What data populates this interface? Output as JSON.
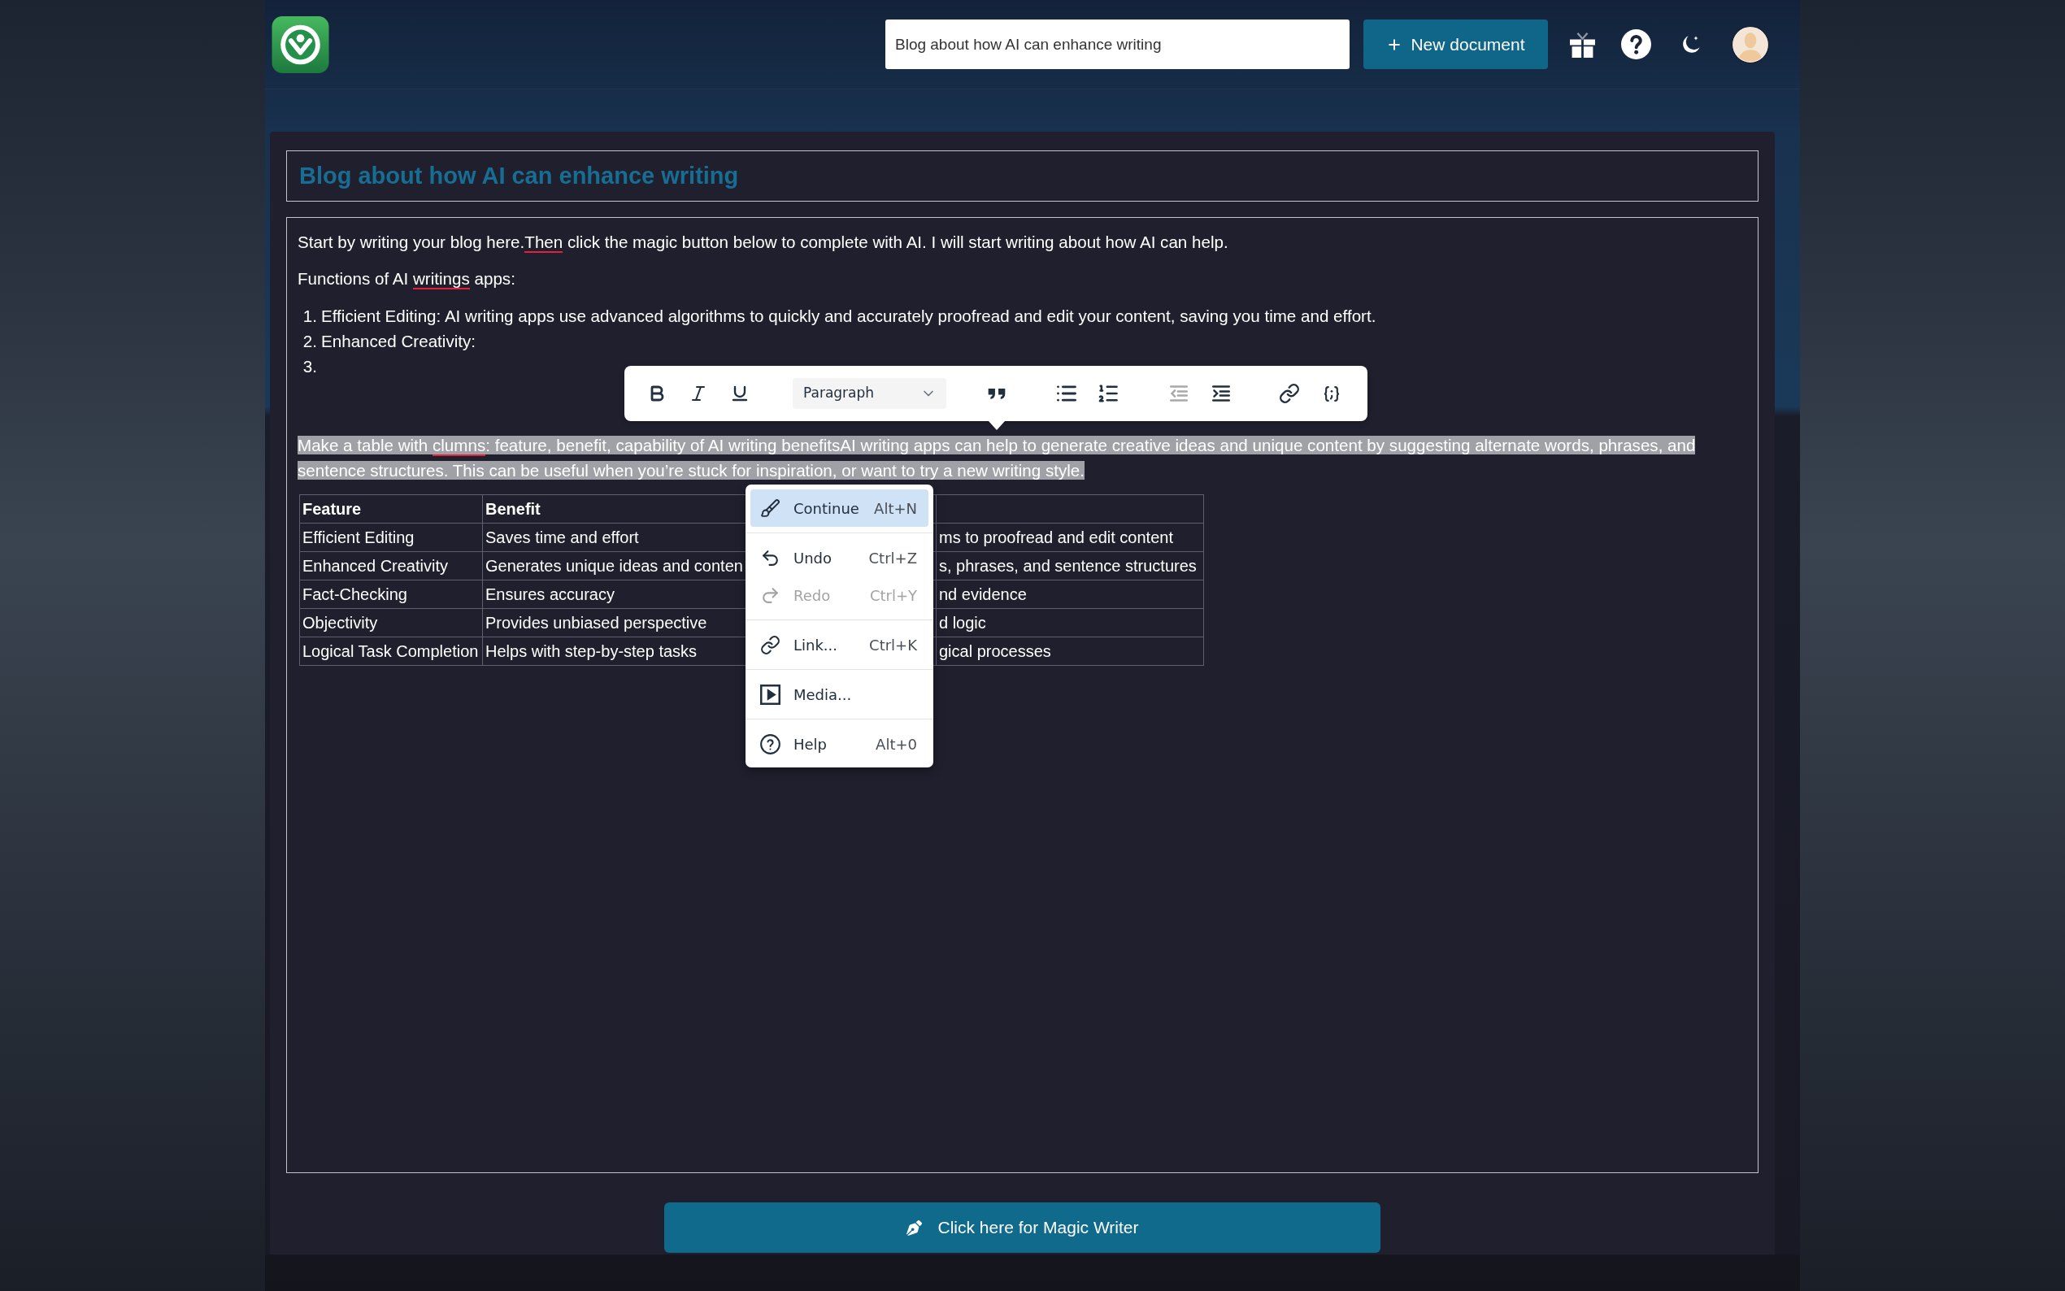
{
  "header": {
    "search": {
      "value": "Blog about how AI can enhance writing"
    },
    "new_button": {
      "label": "New document"
    }
  },
  "document": {
    "title": "Blog about how AI can enhance writing",
    "blocks": [
      {
        "kind": "paragraph",
        "selected": false,
        "segments": [
          {
            "text": "Start by writing your blog here.",
            "misspelled": false
          },
          {
            "text": "Then",
            "misspelled": true
          },
          {
            "text": " click the magic button below to complete with AI. I will start writing about how AI can help.",
            "misspelled": false
          }
        ]
      },
      {
        "kind": "paragraph",
        "selected": false,
        "segments": [
          {
            "text": "Functions of AI ",
            "misspelled": false
          },
          {
            "text": "writings",
            "misspelled": true
          },
          {
            "text": " apps:",
            "misspelled": false
          }
        ]
      },
      {
        "kind": "list",
        "items": [
          {
            "marker": "1.",
            "text": "Efficient Editing: AI writing apps use advanced algorithms to quickly and accurately proofread and edit your content, saving you time and effort."
          },
          {
            "marker": "2.",
            "text": "Enhanced Creativity:"
          },
          {
            "marker": "3."
          }
        ]
      },
      {
        "kind": "paragraph",
        "selected": true,
        "segments": [
          {
            "text": "Make a table with ",
            "misspelled": false
          },
          {
            "text": "clumns",
            "misspelled": true
          },
          {
            "text": ": feature, benefit, capability of AI writing benefitsAI writing apps can help to generate creative ideas and unique content by suggesting alternate words, phrases, and sentence structures. This can be useful when you’re stuck for inspiration, or want to try a new writing style.",
            "misspelled": false
          }
        ]
      },
      {
        "kind": "table",
        "columns": [
          "Feature",
          "Benefit"
        ],
        "rows": [
          [
            "Efficient Editing",
            "Saves time and effort",
            "ms to proofread and edit content"
          ],
          [
            "Enhanced Creativity",
            "Generates unique ideas and conten",
            "s, phrases, and sentence structures"
          ],
          [
            "Fact-Checking",
            "Ensures accuracy",
            "nd evidence"
          ],
          [
            "Objectivity",
            "Provides unbiased perspective",
            "d logic"
          ],
          [
            "Logical Task Completion",
            "Helps with step-by-step tasks",
            "gical processes"
          ]
        ]
      }
    ]
  },
  "toolbar": {
    "items": [
      {
        "kind": "bold",
        "disabled": false
      },
      {
        "kind": "italic",
        "disabled": false
      },
      {
        "kind": "underline",
        "disabled": false
      },
      {
        "kind": "select",
        "value": "Paragraph",
        "disabled": false
      },
      {
        "kind": "blockquote",
        "disabled": false
      },
      {
        "kind": "bullets",
        "disabled": false
      },
      {
        "kind": "numbers",
        "disabled": false
      },
      {
        "kind": "outdent",
        "disabled": true
      },
      {
        "kind": "indent",
        "disabled": false
      },
      {
        "kind": "link",
        "disabled": false
      },
      {
        "kind": "code",
        "disabled": false
      }
    ]
  },
  "context_menu": {
    "groups": [
      {
        "items": [
          {
            "kind": "continue",
            "label": "Continue",
            "shortcut": "Alt+N",
            "selected": true,
            "disabled": false
          }
        ]
      },
      {
        "items": [
          {
            "kind": "undo",
            "label": "Undo",
            "shortcut": "Ctrl+Z",
            "selected": false,
            "disabled": false
          },
          {
            "kind": "redo",
            "label": "Redo",
            "shortcut": "Ctrl+Y",
            "selected": false,
            "disabled": true
          }
        ]
      },
      {
        "items": [
          {
            "kind": "link",
            "label": "Link...",
            "shortcut": "Ctrl+K",
            "selected": false,
            "disabled": false
          }
        ]
      },
      {
        "items": [
          {
            "kind": "media",
            "label": "Media...",
            "selected": false,
            "disabled": false
          }
        ]
      },
      {
        "items": [
          {
            "kind": "help",
            "label": "Help",
            "shortcut": "Alt+0",
            "selected": false,
            "disabled": false
          }
        ]
      }
    ]
  },
  "magic_button": {
    "label": "Click here for Magic Writer"
  }
}
